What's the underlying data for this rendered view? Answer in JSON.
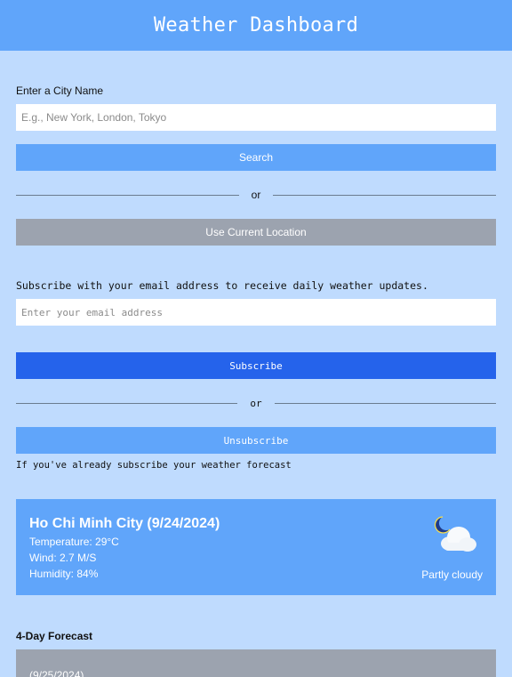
{
  "header": {
    "title": "Weather Dashboard"
  },
  "search": {
    "label": "Enter a City Name",
    "placeholder": "E.g., New York, London, Tokyo",
    "button_label": "Search",
    "divider_text": "or",
    "location_button_label": "Use Current Location"
  },
  "subscribe": {
    "prompt": "Subscribe with your email address to receive daily weather updates.",
    "placeholder": "Enter your email address",
    "button_label": "Subscribe",
    "divider_text": "or",
    "unsubscribe_label": "Unsubscribe",
    "note": "If you've already subscribe your weather forecast"
  },
  "current_weather": {
    "city_date": "Ho Chi Minh City (9/24/2024)",
    "temperature": "Temperature: 29°C",
    "wind": "Wind: 2.7 M/S",
    "humidity": "Humidity: 84%",
    "condition": "Partly cloudy",
    "icon": "partly-cloudy-night-icon"
  },
  "forecast": {
    "title": "4-Day Forecast",
    "days": [
      {
        "date": "(9/25/2024)"
      }
    ]
  }
}
